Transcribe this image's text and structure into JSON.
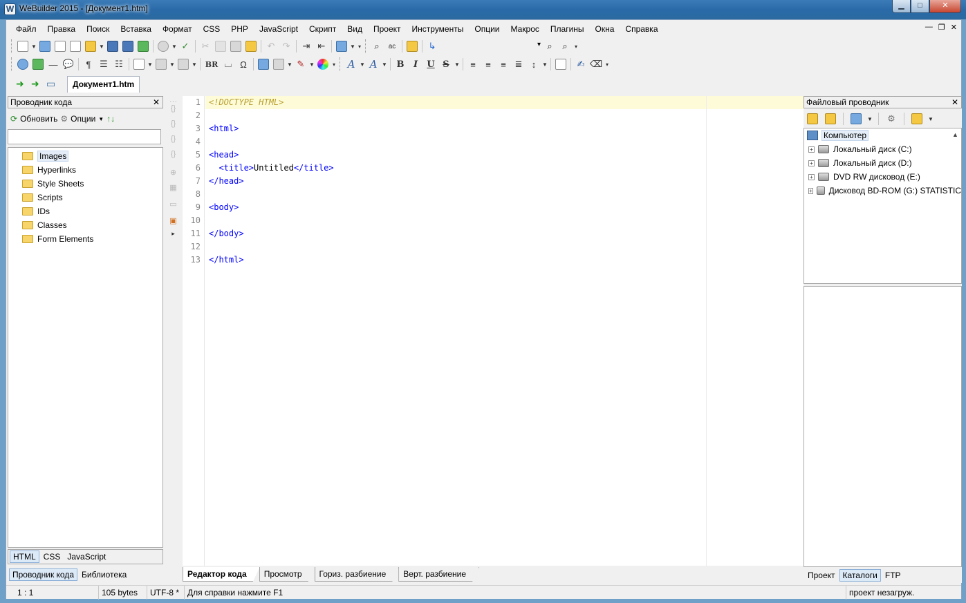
{
  "window": {
    "title": "WeBuilder 2015 - [Документ1.htm]",
    "app_icon_letter": "W",
    "buttons": {
      "minimize": "▁",
      "maximize": "□",
      "close": "✕"
    },
    "mdi_buttons": {
      "minimize": "—",
      "restore": "❐",
      "close": "✕"
    }
  },
  "menu": [
    "Файл",
    "Правка",
    "Поиск",
    "Вставка",
    "Формат",
    "CSS",
    "PHP",
    "JavaScript",
    "Скрипт",
    "Вид",
    "Проект",
    "Инструменты",
    "Опции",
    "Макрос",
    "Плагины",
    "Окна",
    "Справка"
  ],
  "toolbar2_text": {
    "br": "BR",
    "bold": "B",
    "italic": "I",
    "underline": "U",
    "strike": "S",
    "omega": "Ω"
  },
  "doc_tab": {
    "label": "Документ1.htm"
  },
  "code_explorer": {
    "title": "Проводник кода",
    "refresh_label": "Обновить",
    "options_label": "Опции",
    "items": [
      "Images",
      "Hyperlinks",
      "Style Sheets",
      "Scripts",
      "IDs",
      "Classes",
      "Form Elements"
    ],
    "lang_tabs": [
      "HTML",
      "CSS",
      "JavaScript"
    ],
    "bottom_tabs": [
      "Проводник кода",
      "Библиотека"
    ]
  },
  "editor": {
    "line_numbers": [
      "1",
      "2",
      "3",
      "4",
      "5",
      "6",
      "7",
      "8",
      "9",
      "10",
      "11",
      "12",
      "13"
    ],
    "lines": [
      {
        "a": "<!DOCTYPE HTML>",
        "b": "",
        "c": ""
      },
      {
        "a": "",
        "b": "",
        "c": ""
      },
      {
        "a": "<html>",
        "b": "",
        "c": ""
      },
      {
        "a": "",
        "b": "",
        "c": ""
      },
      {
        "a": "<head>",
        "b": "",
        "c": ""
      },
      {
        "a": "  <title>",
        "b": "Untitled",
        "c": "</title>"
      },
      {
        "a": "</head>",
        "b": "",
        "c": ""
      },
      {
        "a": "",
        "b": "",
        "c": ""
      },
      {
        "a": "<body>",
        "b": "",
        "c": ""
      },
      {
        "a": "",
        "b": "",
        "c": ""
      },
      {
        "a": "</body>",
        "b": "",
        "c": ""
      },
      {
        "a": "",
        "b": "",
        "c": ""
      },
      {
        "a": "</html>",
        "b": "",
        "c": ""
      }
    ],
    "tabs": [
      "Редактор кода",
      "Просмотр",
      "Гориз. разбиение",
      "Верт. разбиение"
    ]
  },
  "file_explorer": {
    "title": "Файловый проводник",
    "root": "Компьютер",
    "drives": [
      "Локальный диск (C:)",
      "Локальный диск (D:)",
      "DVD RW дисковод (E:)",
      "Дисковод BD-ROM (G:) STATISTIC"
    ],
    "bottom_tabs": [
      "Проект",
      "Каталоги",
      "FTP"
    ]
  },
  "status": {
    "position": "1 : 1",
    "size": "105 bytes",
    "encoding": "UTF-8 *",
    "help": "Для справки нажмите F1",
    "project": "проект незагруж."
  },
  "colors": {
    "tag": "#0000ff",
    "doctype": "#b8a030",
    "current_line": "#fefbd8",
    "title_bar": "#2a6aa8"
  }
}
